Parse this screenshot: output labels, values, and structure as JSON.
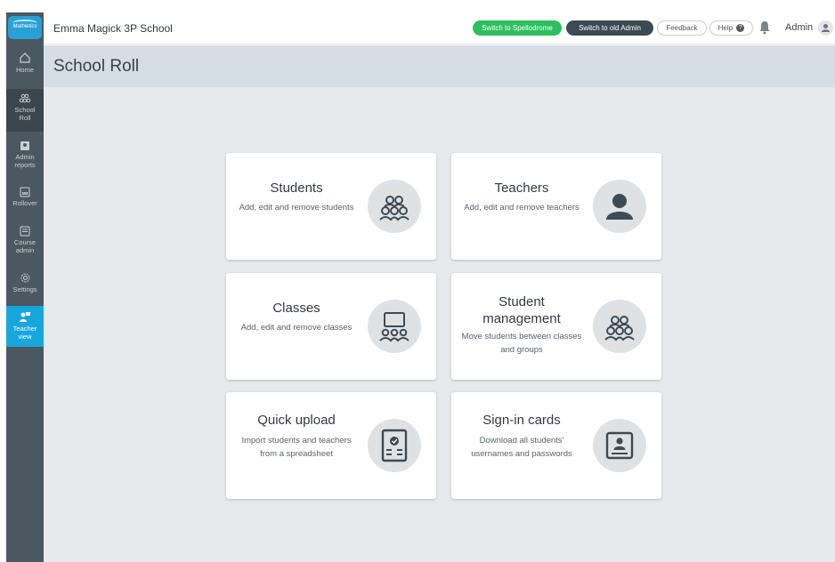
{
  "app": {
    "logo_text": "Mathletics",
    "school_name": "Emma Magick 3P School",
    "page_title": "School Roll"
  },
  "header": {
    "switch_spellodrome": "Switch to Spellodrome",
    "switch_old_admin": "Switch to old Admin",
    "feedback": "Feedback",
    "help": "Help",
    "help_icon": "?",
    "admin": "Admin"
  },
  "sidebar": {
    "items": [
      {
        "label": "Home",
        "icon": "home-icon"
      },
      {
        "label": "School Roll",
        "icon": "people-icon"
      },
      {
        "label": "Admin reports",
        "icon": "report-icon"
      },
      {
        "label": "Rollover",
        "icon": "rollover-icon"
      },
      {
        "label": "Course admin",
        "icon": "course-icon"
      },
      {
        "label": "Settings",
        "icon": "gear-icon"
      },
      {
        "label": "Teacher view",
        "icon": "teacher-view-icon"
      }
    ]
  },
  "cards": [
    {
      "title": "Students",
      "desc": "Add, edit and remove students",
      "icon": "students-icon"
    },
    {
      "title": "Teachers",
      "desc": "Add, edit and remove teachers",
      "icon": "teacher-icon"
    },
    {
      "title": "Classes",
      "desc": "Add, edit and remove classes",
      "icon": "classroom-icon"
    },
    {
      "title": "Student management",
      "desc": "Move students between classes and groups",
      "icon": "students-icon"
    },
    {
      "title": "Quick upload",
      "desc": "Import students and teachers from a spreadsheet",
      "icon": "upload-document-icon"
    },
    {
      "title": "Sign-in cards",
      "desc": "Download all students' usernames and passwords",
      "icon": "id-card-icon"
    }
  ],
  "colors": {
    "sidebar": "#4c5860",
    "sidebar_active": "#17a7dd",
    "spellodrome_button": "#2dbe5e",
    "old_admin_button": "#3c4a53",
    "header_band": "#d6dee5",
    "main_background": "#e8e9eb"
  }
}
